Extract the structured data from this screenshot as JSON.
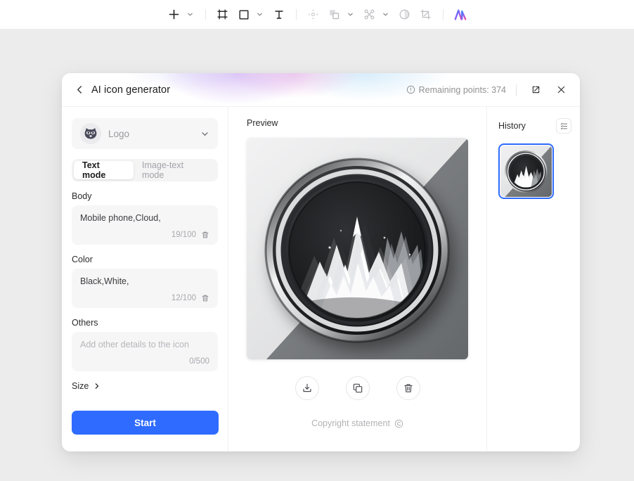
{
  "toolbar": {
    "items": [
      {
        "name": "add-icon",
        "glyph": "plus",
        "has_caret": true
      },
      {
        "name": "frame-icon",
        "glyph": "frame",
        "has_caret": false
      },
      {
        "name": "rectangle-icon",
        "glyph": "square",
        "has_caret": true
      },
      {
        "name": "text-icon",
        "glyph": "text",
        "has_caret": false
      },
      {
        "name": "move-icon",
        "glyph": "move",
        "has_caret": false
      },
      {
        "name": "shapes-icon",
        "glyph": "shapes",
        "has_caret": true
      },
      {
        "name": "nodes-icon",
        "glyph": "nodes",
        "has_caret": true
      },
      {
        "name": "contrast-icon",
        "glyph": "contrast",
        "has_caret": false
      },
      {
        "name": "crop-icon",
        "glyph": "crop",
        "has_caret": false
      },
      {
        "name": "ai-logo-icon",
        "glyph": "ai",
        "has_caret": false
      }
    ]
  },
  "modal": {
    "title": "AI icon generator",
    "back_label": "Back",
    "points_text": "Remaining points: 374",
    "expand_label": "Expand",
    "close_label": "Close"
  },
  "left": {
    "logo_select": {
      "label": "Logo",
      "avatar": "raccoon-avatar"
    },
    "modes": [
      {
        "label": "Text mode",
        "active": true
      },
      {
        "label": "Image-text mode",
        "active": false
      }
    ],
    "fields": [
      {
        "label": "Body",
        "value": "Mobile phone,Cloud,",
        "placeholder": "",
        "counter": "19/100"
      },
      {
        "label": "Color",
        "value": "Black,White,",
        "placeholder": "",
        "counter": "12/100"
      },
      {
        "label": "Others",
        "value": "",
        "placeholder": "Add other details to the icon",
        "counter": "0/500"
      }
    ],
    "size": {
      "label": "Size"
    },
    "start_button": "Start"
  },
  "center": {
    "preview_label": "Preview",
    "actions": [
      {
        "name": "download-button",
        "label": "Download"
      },
      {
        "name": "copy-button",
        "label": "Copy"
      },
      {
        "name": "delete-button",
        "label": "Delete"
      }
    ],
    "copyright_text": "Copyright statement"
  },
  "right": {
    "history_title": "History",
    "list_button_label": "List view",
    "items": [
      {
        "name": "history-thumbnail",
        "selected": true
      }
    ]
  },
  "colors": {
    "accent": "#2f6bff",
    "canvas": "#ececec",
    "panel": "#ffffff",
    "field_bg": "#f6f6f7"
  }
}
